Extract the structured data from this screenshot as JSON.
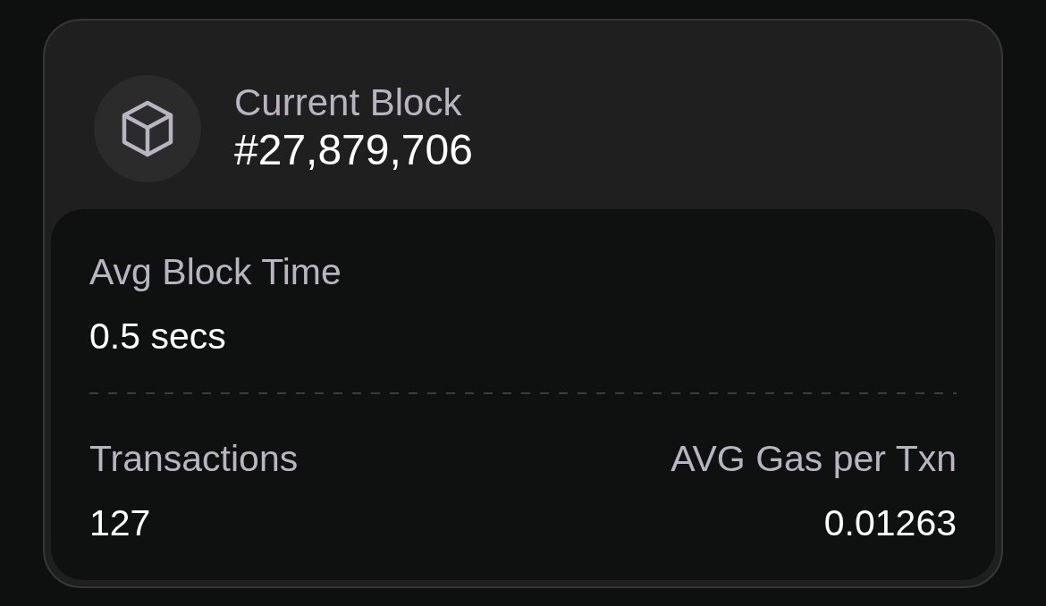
{
  "header": {
    "label": "Current Block",
    "value": "#27,879,706"
  },
  "sections": [
    {
      "stats": [
        {
          "label": "Avg Block Time",
          "value": "0.5 secs"
        }
      ]
    },
    {
      "stats": [
        {
          "label": "Transactions",
          "value": "127"
        },
        {
          "label": "AVG Gas per Txn",
          "value": "0.01263"
        }
      ]
    }
  ]
}
